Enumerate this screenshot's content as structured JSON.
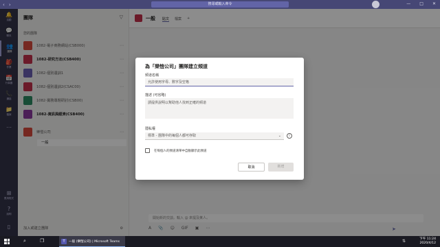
{
  "titlebar": {
    "search_text": "搜尋或輸入命令",
    "nav_back": "‹",
    "nav_forward": "›",
    "compose_icon": "✎",
    "minimize": "—",
    "maximize": "□",
    "close": "✕"
  },
  "rail": {
    "items": [
      {
        "icon": "🔔",
        "label": "活動"
      },
      {
        "icon": "💬",
        "label": "聊天"
      },
      {
        "icon": "👥",
        "label": "團隊"
      },
      {
        "icon": "🎒",
        "label": "作業"
      },
      {
        "icon": "📅",
        "label": "行事曆"
      },
      {
        "icon": "📞",
        "label": "通話"
      },
      {
        "icon": "📁",
        "label": "檔案"
      },
      {
        "icon": "⋯",
        "label": ""
      }
    ],
    "apps_icon": "⊞",
    "apps_label": "應用程式",
    "help_icon": "?",
    "help_label": "說明",
    "device_icon": "▯"
  },
  "teams_panel": {
    "title": "團隊",
    "filter_icon": "▽",
    "section_label": "您的團隊",
    "teams": [
      {
        "name": "1082-電子商務網站(CSB000)",
        "color": "#d74a3c",
        "bold": false
      },
      {
        "name": "1082-研究方法(CSB400)",
        "color": "#c4314b",
        "bold": true
      },
      {
        "name": "1082-個別遺訓1",
        "color": "#6b5fb3",
        "bold": false
      },
      {
        "name": "1082-個別遺訓2(CSAC00)",
        "color": "#c4314b",
        "bold": false
      },
      {
        "name": "1082-實務專題研討(CSB00)",
        "color": "#2c8a63",
        "bold": false
      },
      {
        "name": "1082-資訊與經濟(CSB400)",
        "color": "#8b3a9e",
        "bold": true
      },
      {
        "name": "樂愷公司",
        "color": "#d74a3c",
        "bold": false
      }
    ],
    "more_icon": "⋯",
    "channel_general": "一般",
    "join_label": "加入或建立團隊",
    "settings_icon": "⚙"
  },
  "main": {
    "title": "一般",
    "tabs": [
      "貼文",
      "檔案",
      "+"
    ],
    "compose_placeholder": "開始新的交談。輸入 @ 來提及某人。",
    "compose_tools": [
      "A",
      "📎",
      "☺",
      "GIF",
      "▣",
      "⋯"
    ],
    "send_icon": "➤"
  },
  "dialog": {
    "title": "為「樂愷公司」團隊建立頻道",
    "name_label": "頻道名稱",
    "name_placeholder": "允許使用字母、數字及空格",
    "desc_label": "描述 (可省略)",
    "desc_placeholder": "請提供說明以幫助他人找到正確的頻道",
    "privacy_label": "隱私權",
    "privacy_value": "標準 - 團隊中的每個人都可存取",
    "privacy_chevron": "⌄",
    "info_icon": "i",
    "checkbox_label": "在每個人的頻道清單中自動顯示此頻道",
    "cancel_label": "取消",
    "add_label": "新增"
  },
  "taskbar": {
    "search_icon": "⌕",
    "taskview_icon": "❐",
    "app_logo": "T",
    "app_label": "一般 (樂愷公司) | Microsoft Teams",
    "tray_icon": "⇅",
    "time": "下午 11:24",
    "date": "2020/4/12"
  }
}
